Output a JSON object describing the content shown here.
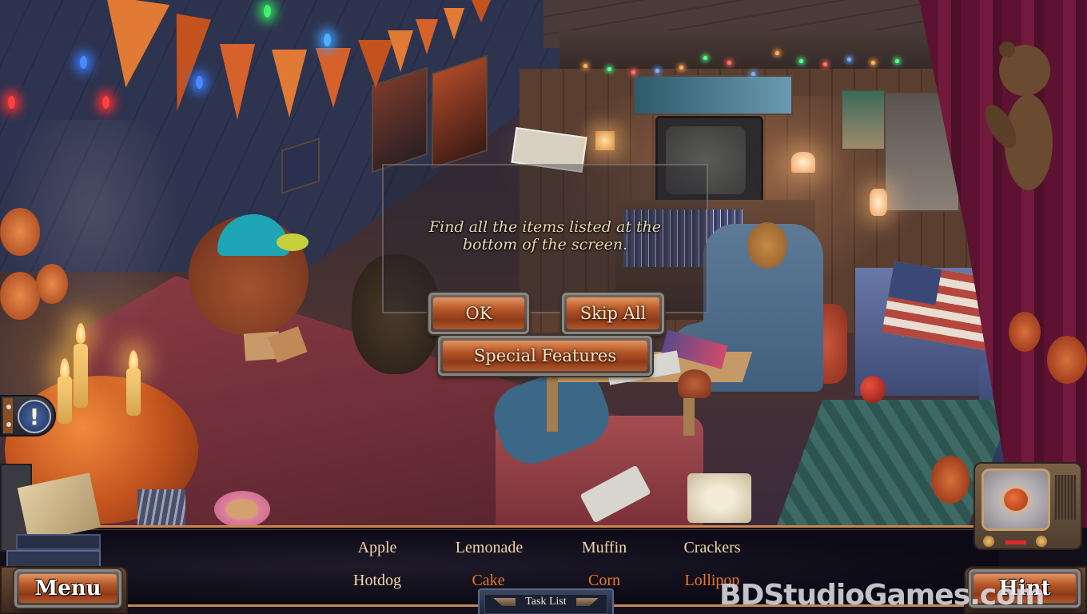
{
  "game": {
    "scene": "Attic hangout room with Halloween decorations",
    "dialog": {
      "message_line1": "Find all the items listed at the",
      "message_line2": "bottom of the screen.",
      "buttons": {
        "ok": "OK",
        "skip_all": "Skip All",
        "special_features": "Special Features"
      }
    },
    "hud": {
      "menu_label": "Menu",
      "hint_label": "Hint",
      "task_list_label": "Task List",
      "alert_icon": "exclamation-icon",
      "tasks": [
        {
          "label": "Apple",
          "found": false
        },
        {
          "label": "Lemonade",
          "found": false
        },
        {
          "label": "Muffin",
          "found": false
        },
        {
          "label": "Crackers",
          "found": false
        },
        {
          "label": "Hotdog",
          "found": false
        },
        {
          "label": "Cake",
          "found": true
        },
        {
          "label": "Corn",
          "found": true
        },
        {
          "label": "Lollipop",
          "found": true
        }
      ]
    },
    "colors": {
      "task_normal": "#f1d6a8",
      "task_highlight": "#e8762e",
      "hud_border": "#c98652",
      "button_wood": "#b85a2a"
    }
  },
  "watermark": "BDStudioGames.com"
}
